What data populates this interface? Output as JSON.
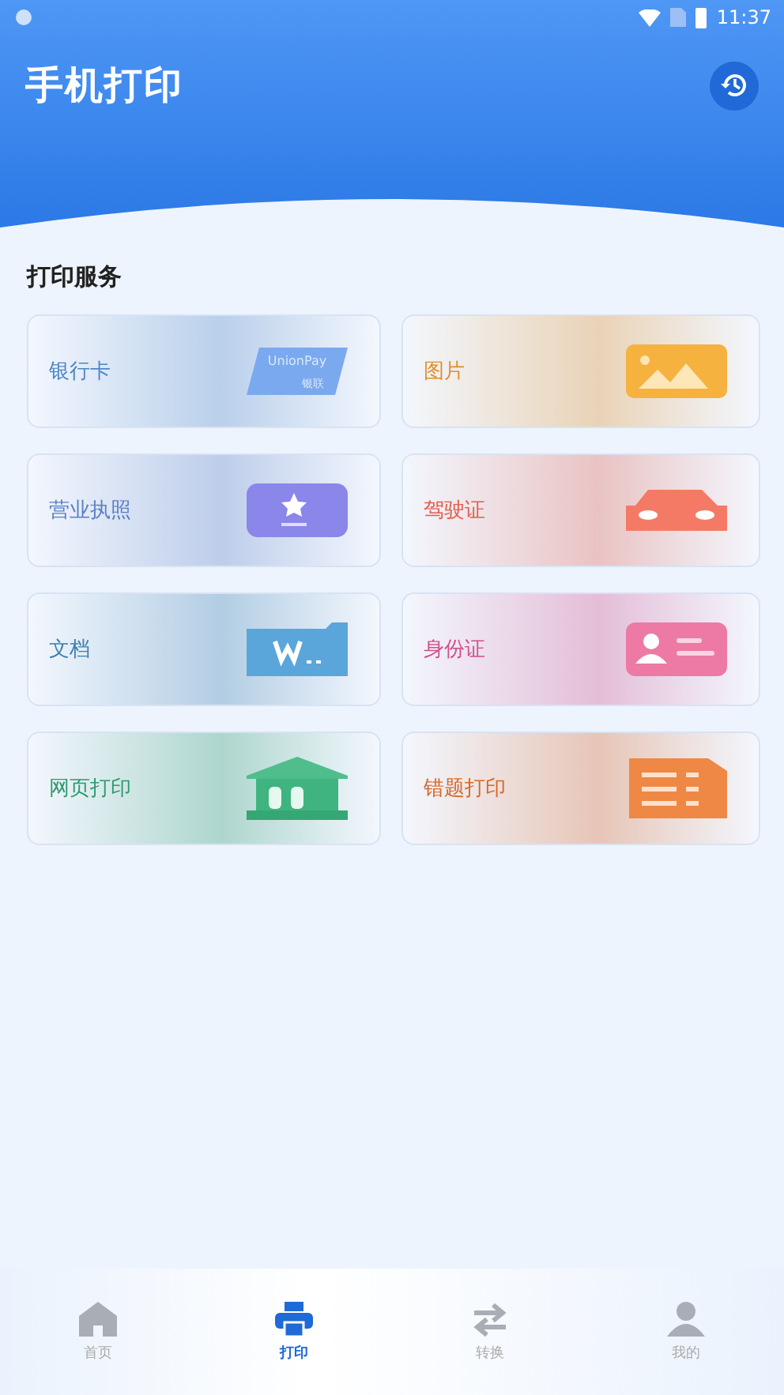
{
  "status_bar": {
    "time": "11:37"
  },
  "header": {
    "title": "手机打印"
  },
  "section": {
    "title": "打印服务"
  },
  "services": [
    {
      "label": "银行卡",
      "kind": "bankcard",
      "color": "#4f86c6",
      "icon_texts": [
        "UnionPay",
        "银联"
      ]
    },
    {
      "label": "图片",
      "kind": "picture",
      "color": "#e0902a"
    },
    {
      "label": "营业执照",
      "kind": "license",
      "color": "#5b7fc4"
    },
    {
      "label": "驾驶证",
      "kind": "car",
      "color": "#e0604e"
    },
    {
      "label": "文档",
      "kind": "document",
      "color": "#3b7fb0"
    },
    {
      "label": "身份证",
      "kind": "idcard",
      "color": "#d0508a"
    },
    {
      "label": "网页打印",
      "kind": "bank",
      "color": "#2e9a6e"
    },
    {
      "label": "错题打印",
      "kind": "list",
      "color": "#d9672a"
    }
  ],
  "nav": [
    {
      "label": "首页",
      "kind": "home",
      "selected": false
    },
    {
      "label": "打印",
      "kind": "printer",
      "selected": true
    },
    {
      "label": "转换",
      "kind": "swap",
      "selected": false
    },
    {
      "label": "我的",
      "kind": "person",
      "selected": false
    }
  ]
}
